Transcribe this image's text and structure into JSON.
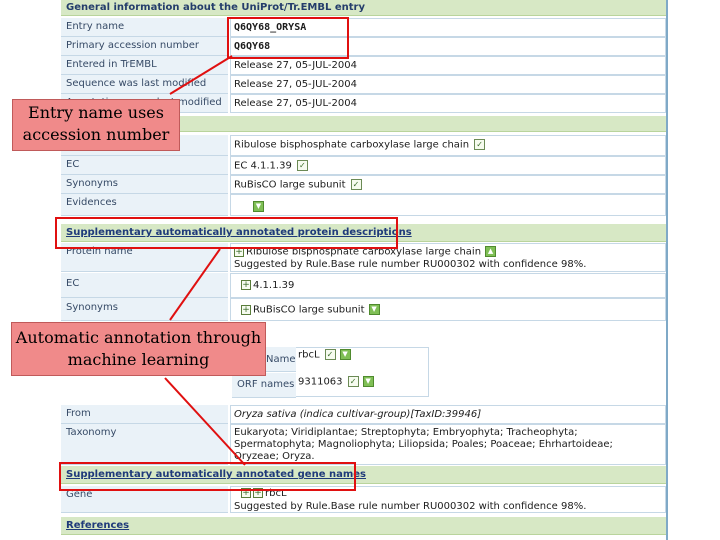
{
  "sections": {
    "general": "General information about the UniProt/Tr.EMBL entry",
    "supp_protein": "Supplementary automatically annotated protein descriptions",
    "supp_gene": "Supplementary automatically annotated gene names",
    "references": "References"
  },
  "general_rows": [
    {
      "label": "Entry name",
      "value": "Q6QY68_ORYSA"
    },
    {
      "label": "Primary accession number",
      "value": "Q6QY68"
    },
    {
      "label": "Entered in TrEMBL",
      "value": "Release 27, 05-JUL-2004"
    },
    {
      "label": "Sequence was last modified",
      "value": "Release 27, 05-JUL-2004"
    },
    {
      "label": "Annotations were last modified",
      "value": "Release 27, 05-JUL-2004"
    }
  ],
  "desc_rows": {
    "protein_name": "Ribulose bisphosphate carboxylase large chain",
    "ec_label": "EC",
    "ec_value": "EC 4.1.1.39",
    "synonyms_label": "Synonyms",
    "synonyms_value": "RuBisCO large subunit",
    "evidences_label": "Evidences"
  },
  "supp_protein_rows": {
    "protein_name_label": "Protein name",
    "protein_name_value": "Ribulose bisphosphate carboxylase large chain",
    "protein_name_note": "Suggested by Rule.Base rule number RU000302 with confidence 98%.",
    "ec_label": "EC",
    "ec_value": "4.1.1.39",
    "synonyms_label": "Synonyms",
    "synonyms_value": "RuBisCO large subunit"
  },
  "gene_rows": {
    "name_label": "Name",
    "name_value": "rbcL",
    "orf_label": "ORF names",
    "orf_value": "9311063"
  },
  "from_row": {
    "label": "From",
    "value": "Oryza sativa (indica cultivar-group)[TaxID:39946]"
  },
  "taxonomy_row": {
    "label": "Taxonomy",
    "lines": [
      "Eukaryota; Viridiplantae; Streptophyta; Embryophyta; Tracheophyta;",
      "Spermatophyta; Magnoliophyta; Liliopsida; Poales; Poaceae; Ehrhartoideae;",
      "Oryzeae; Oryza."
    ]
  },
  "gene_row": {
    "label": "Gene",
    "value": "rbcL",
    "note": "Suggested by Rule.Base rule number RU000302 with confidence 98%."
  },
  "callouts": {
    "entry_name": "Entry name uses accession number",
    "automatic": "Automatic annotation through machine learning"
  },
  "colors": {
    "highlight_box": "#e01010",
    "callout_fill": "#f08a8a",
    "section_bg": "#d7e8c5",
    "label_bg": "#eaf2f8"
  }
}
